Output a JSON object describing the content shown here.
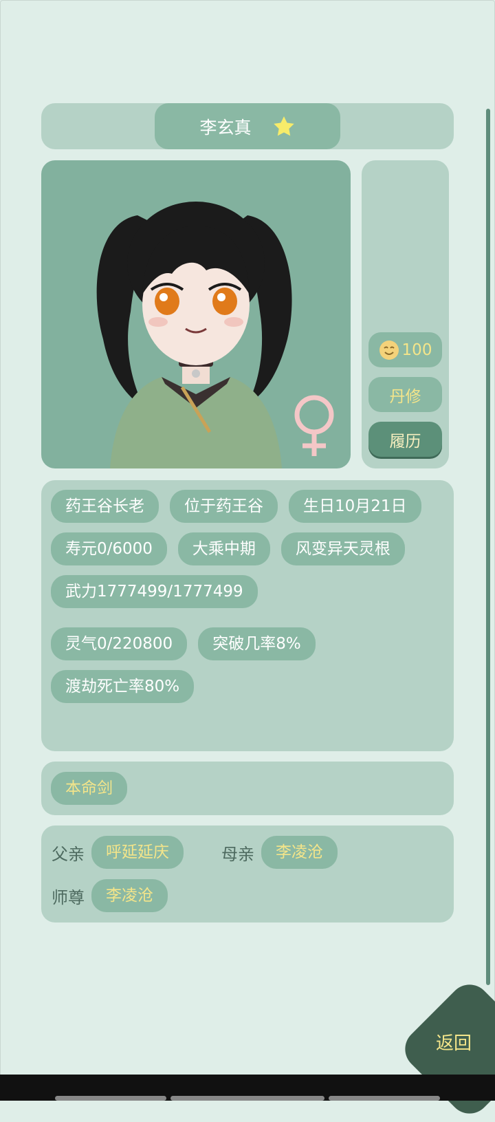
{
  "character": {
    "name": "李玄真",
    "favorite_icon": "star-icon"
  },
  "portrait": {
    "gender_icon": "female-symbol-icon"
  },
  "side_panel": {
    "mood": {
      "icon": "smiling-face-icon",
      "value": "100"
    },
    "profession_label": "丹修",
    "resume_label": "履历"
  },
  "info_tags": [
    "药王谷长老",
    "位于药王谷",
    "生日10月21日",
    "寿元0/6000",
    "大乘中期",
    "风变异天灵根",
    "武力1777499/1777499",
    "灵气0/220800",
    "突破几率8%",
    "渡劫死亡率80%"
  ],
  "equipment": {
    "label": "本命剑"
  },
  "relations": {
    "father": {
      "label": "父亲",
      "name": "呼延延庆"
    },
    "mother": {
      "label": "母亲",
      "name": "李凌沧"
    },
    "master": {
      "label": "师尊",
      "name": "李凌沧"
    }
  },
  "back_button": {
    "label": "返回"
  },
  "colors": {
    "background": "#dfeee8",
    "panel": "#b5d2c6",
    "chip": "#8ab8a4",
    "accent_gold": "#f4e58a",
    "back_button": "#3f5e4e"
  }
}
